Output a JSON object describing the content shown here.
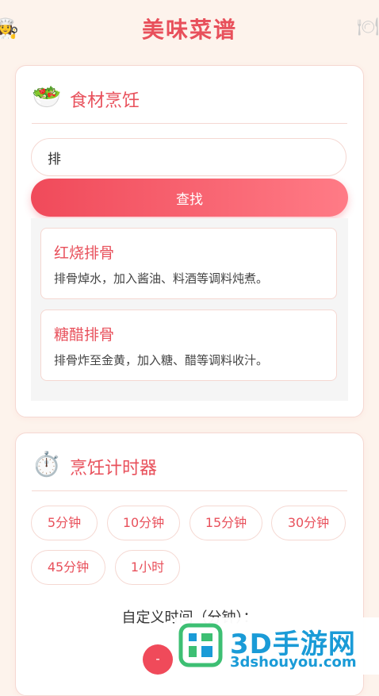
{
  "header": {
    "title": "美味菜谱",
    "left_icon": "chef-icon",
    "right_icon": "utensils-icon"
  },
  "ingredients": {
    "icon": "salad-bowl-icon",
    "title": "食材烹饪",
    "search_value": "排",
    "search_button": "查找",
    "results": [
      {
        "name": "红烧排骨",
        "desc": "排骨焯水，加入酱油、料酒等调料炖煮。"
      },
      {
        "name": "糖醋排骨",
        "desc": "排骨炸至金黄，加入糖、醋等调料收汁。"
      }
    ]
  },
  "timer": {
    "icon": "stopwatch-icon",
    "title": "烹饪计时器",
    "presets": [
      "5分钟",
      "10分钟",
      "15分钟",
      "30分钟",
      "45分钟",
      "1小时"
    ],
    "custom_label": "自定义时间（分钟）：",
    "minus_label": "-"
  },
  "watermark": {
    "title": "3D手游网",
    "subtitle": "3dshouyou.com"
  },
  "colors": {
    "accent": "#e8505b",
    "background": "#fdf3ec",
    "watermark": "#1a9bd7"
  }
}
